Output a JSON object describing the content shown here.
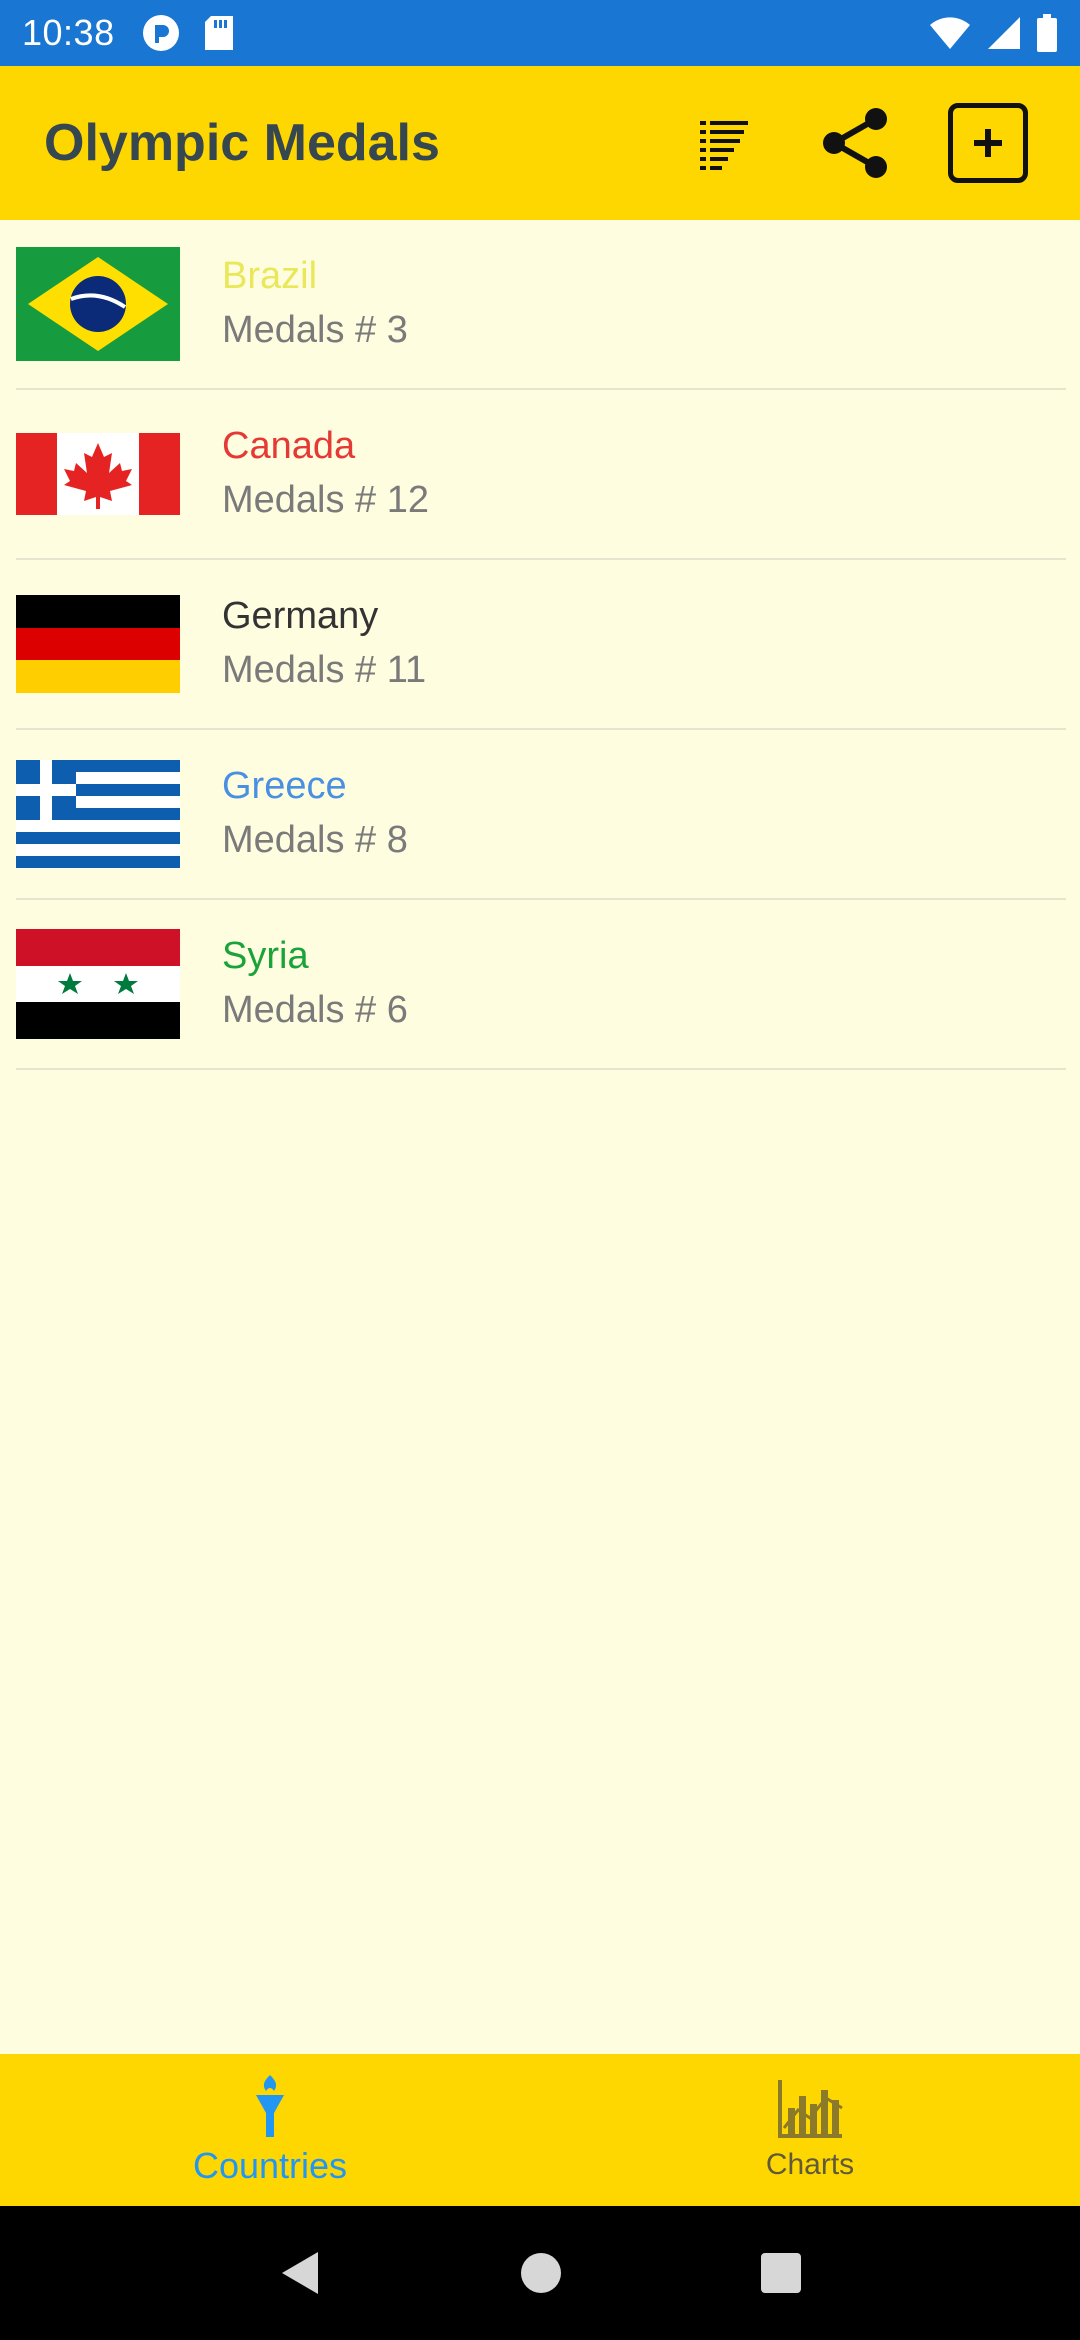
{
  "status_bar": {
    "time": "10:38",
    "left_icons": [
      "sync-icon",
      "sd-card-icon"
    ],
    "right_icons": [
      "wifi-icon",
      "signal-icon",
      "battery-icon"
    ]
  },
  "app_bar": {
    "title": "Olympic Medals",
    "actions": [
      "sort-icon",
      "share-icon",
      "add-icon"
    ],
    "background": "#FFD700"
  },
  "countries": [
    {
      "name": "Brazil",
      "medals": "Medals # 3",
      "color": "#E8E85A",
      "flag": "brazil-flag"
    },
    {
      "name": "Canada",
      "medals": "Medals # 12",
      "color": "#E53935",
      "flag": "canada-flag"
    },
    {
      "name": "Germany",
      "medals": "Medals # 11",
      "color": "#333333",
      "flag": "germany-flag"
    },
    {
      "name": "Greece",
      "medals": "Medals # 8",
      "color": "#4A90E2",
      "flag": "greece-flag"
    },
    {
      "name": "Syria",
      "medals": "Medals # 6",
      "color": "#1AA33A",
      "flag": "syria-flag"
    }
  ],
  "bottom_nav": {
    "tabs": [
      {
        "label": "Countries",
        "icon": "torch-icon",
        "active": true
      },
      {
        "label": "Charts",
        "icon": "bar-chart-icon",
        "active": false
      }
    ]
  },
  "colors": {
    "status_bar": "#1976D2",
    "accent": "#FFD700",
    "list_background": "#FFFDE0",
    "active_tab": "#2196F3"
  }
}
